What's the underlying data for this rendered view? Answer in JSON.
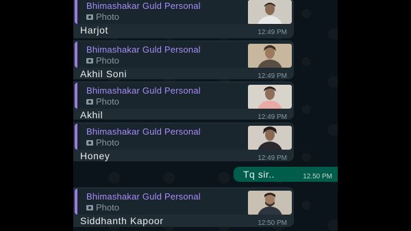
{
  "chat": {
    "messages": [
      {
        "sender": "Bhimashakar Guld Personal",
        "type_label": "Photo",
        "text": "Harjot",
        "time": "12:49 PM"
      },
      {
        "sender": "Bhimashakar Guld Personal",
        "type_label": "Photo",
        "text": "Akhil Soni",
        "time": "12:49 PM"
      },
      {
        "sender": "Bhimashakar Guld Personal",
        "type_label": "Photo",
        "text": "Akhil",
        "time": "12:49 PM"
      },
      {
        "sender": "Bhimashakar Guld Personal",
        "type_label": "Photo",
        "text": "Honey",
        "time": "12:49 PM"
      },
      {
        "sender": "Bhimashakar Guld Personal",
        "type_label": "Photo",
        "text": "Siddhanth Kapoor",
        "time": "12:50 PM"
      }
    ],
    "outgoing": {
      "text": "Tq sir..",
      "time": "12.50 PM"
    }
  },
  "colors": {
    "incoming_bubble": "#1f2c33",
    "outgoing_bubble": "#005c4b",
    "quote_accent": "#9b7be0",
    "background": "#0b141a"
  }
}
